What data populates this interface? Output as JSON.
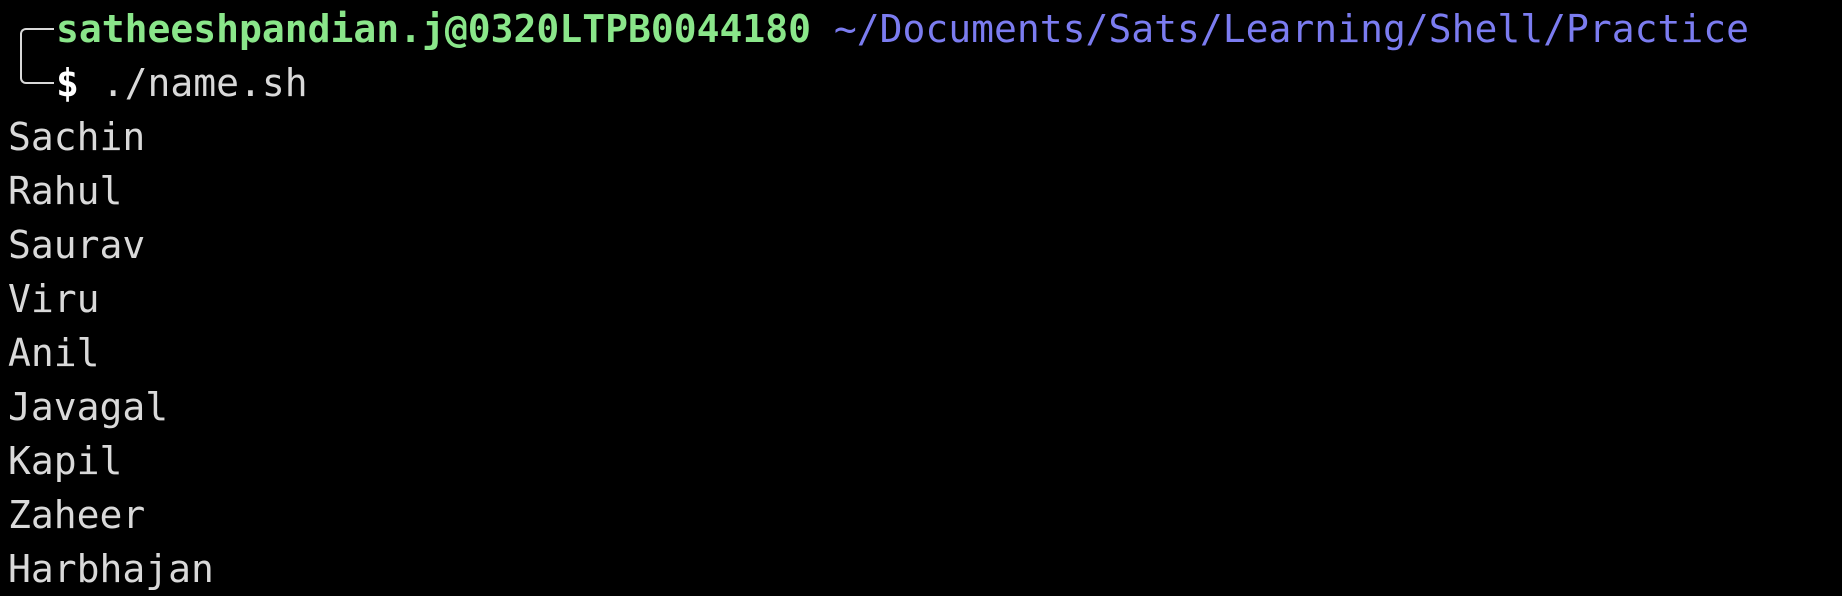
{
  "prompt": {
    "user_host": "satheeshpandian.j@0320LTPB0044180",
    "path": "~/Documents/Sats/Learning/Shell/Practice",
    "symbol": "$",
    "command": "./name.sh"
  },
  "output": [
    "Sachin",
    "Rahul",
    "Saurav",
    "Viru",
    "Anil",
    "Javagal",
    "Kapil",
    "Zaheer",
    "Harbhajan"
  ],
  "colors": {
    "background": "#000000",
    "user_host": "#8ae68a",
    "path": "#7b7cf0",
    "text": "#d9d9d9"
  }
}
